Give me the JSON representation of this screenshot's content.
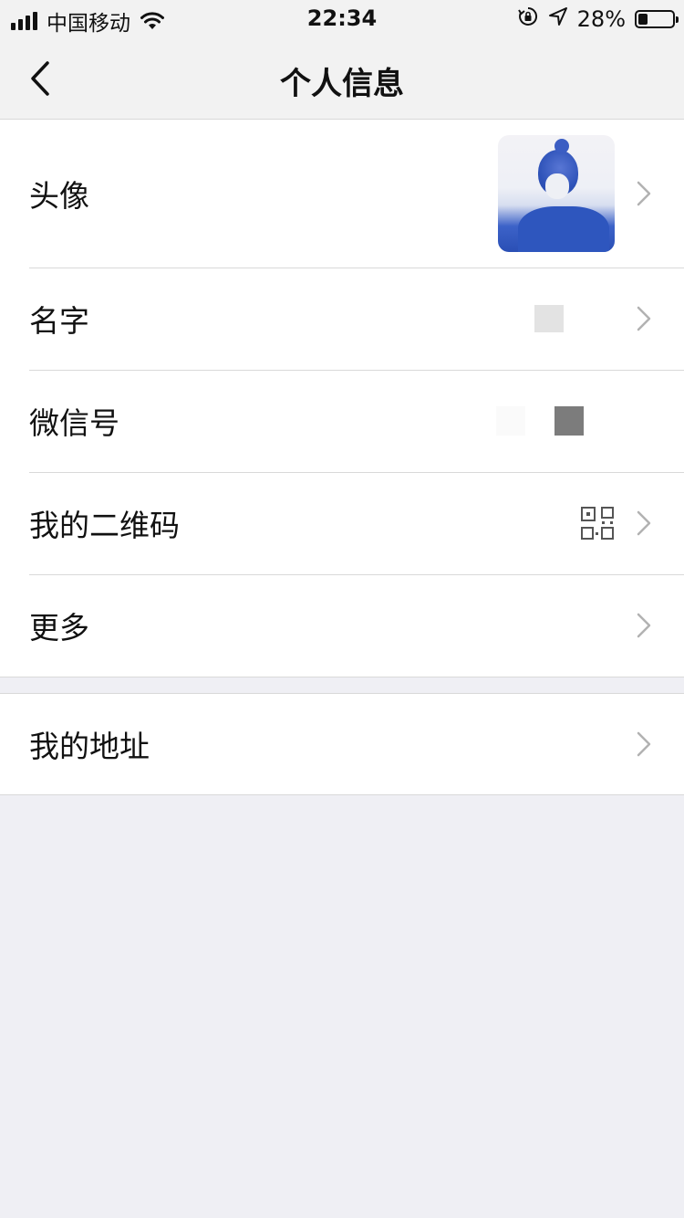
{
  "status_bar": {
    "carrier": "中国移动",
    "time": "22:34",
    "battery_text": "28%",
    "battery_level": 0.28
  },
  "nav": {
    "title": "个人信息",
    "back_icon": "chevron-left-icon"
  },
  "profile_rows": [
    {
      "label": "头像"
    },
    {
      "label": "名字"
    },
    {
      "label": "微信号"
    },
    {
      "label": "我的二维码"
    },
    {
      "label": "更多"
    }
  ],
  "address_row": {
    "label": "我的地址"
  },
  "colors": {
    "background": "#efeff4",
    "row_background": "#ffffff",
    "separator": "#d9d9d9",
    "chevron": "#b2b2b2"
  }
}
